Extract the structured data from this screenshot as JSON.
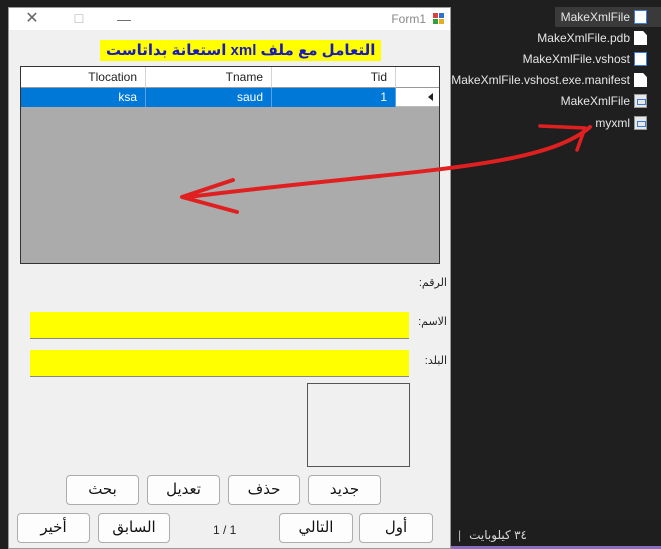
{
  "explorer": {
    "files": [
      {
        "name": "MakeXmlFile",
        "icon": "window-icon"
      },
      {
        "name": "MakeXmlFile.pdb",
        "icon": "file-icon"
      },
      {
        "name": "MakeXmlFile.vshost",
        "icon": "window-icon"
      },
      {
        "name": "MakeXmlFile.vshost.exe.manifest",
        "icon": "file-icon"
      },
      {
        "name": "MakeXmlFile",
        "icon": "config-icon"
      },
      {
        "name": "myxml",
        "icon": "config-icon"
      }
    ],
    "status": {
      "size": "٣٤ كيلوبايت",
      "separator": "|"
    }
  },
  "form": {
    "title": "Form1",
    "controls": {
      "close": "✕",
      "maximize": "☐",
      "minimize": "—"
    },
    "header": "التعامل مع ملف xml  استعانة بداتاست",
    "grid": {
      "columns": [
        "Tlocation",
        "Tname",
        "Tid"
      ],
      "rows": [
        {
          "Tlocation": "ksa",
          "Tname": "saud",
          "Tid": "1"
        }
      ]
    },
    "fields": {
      "number_label": "الرقم:",
      "name_label": "الاسم:",
      "name_value": "",
      "country_label": "البلد:",
      "country_value": ""
    },
    "buttons": {
      "new": "جديد",
      "delete": "حذف",
      "edit": "تعديل",
      "search": "بحث",
      "first": "أول",
      "next": "التالي",
      "previous": "السابق",
      "last": "أخير"
    },
    "pager": "1 / 1"
  },
  "annotation": {
    "arrow_color": "#e02020"
  }
}
